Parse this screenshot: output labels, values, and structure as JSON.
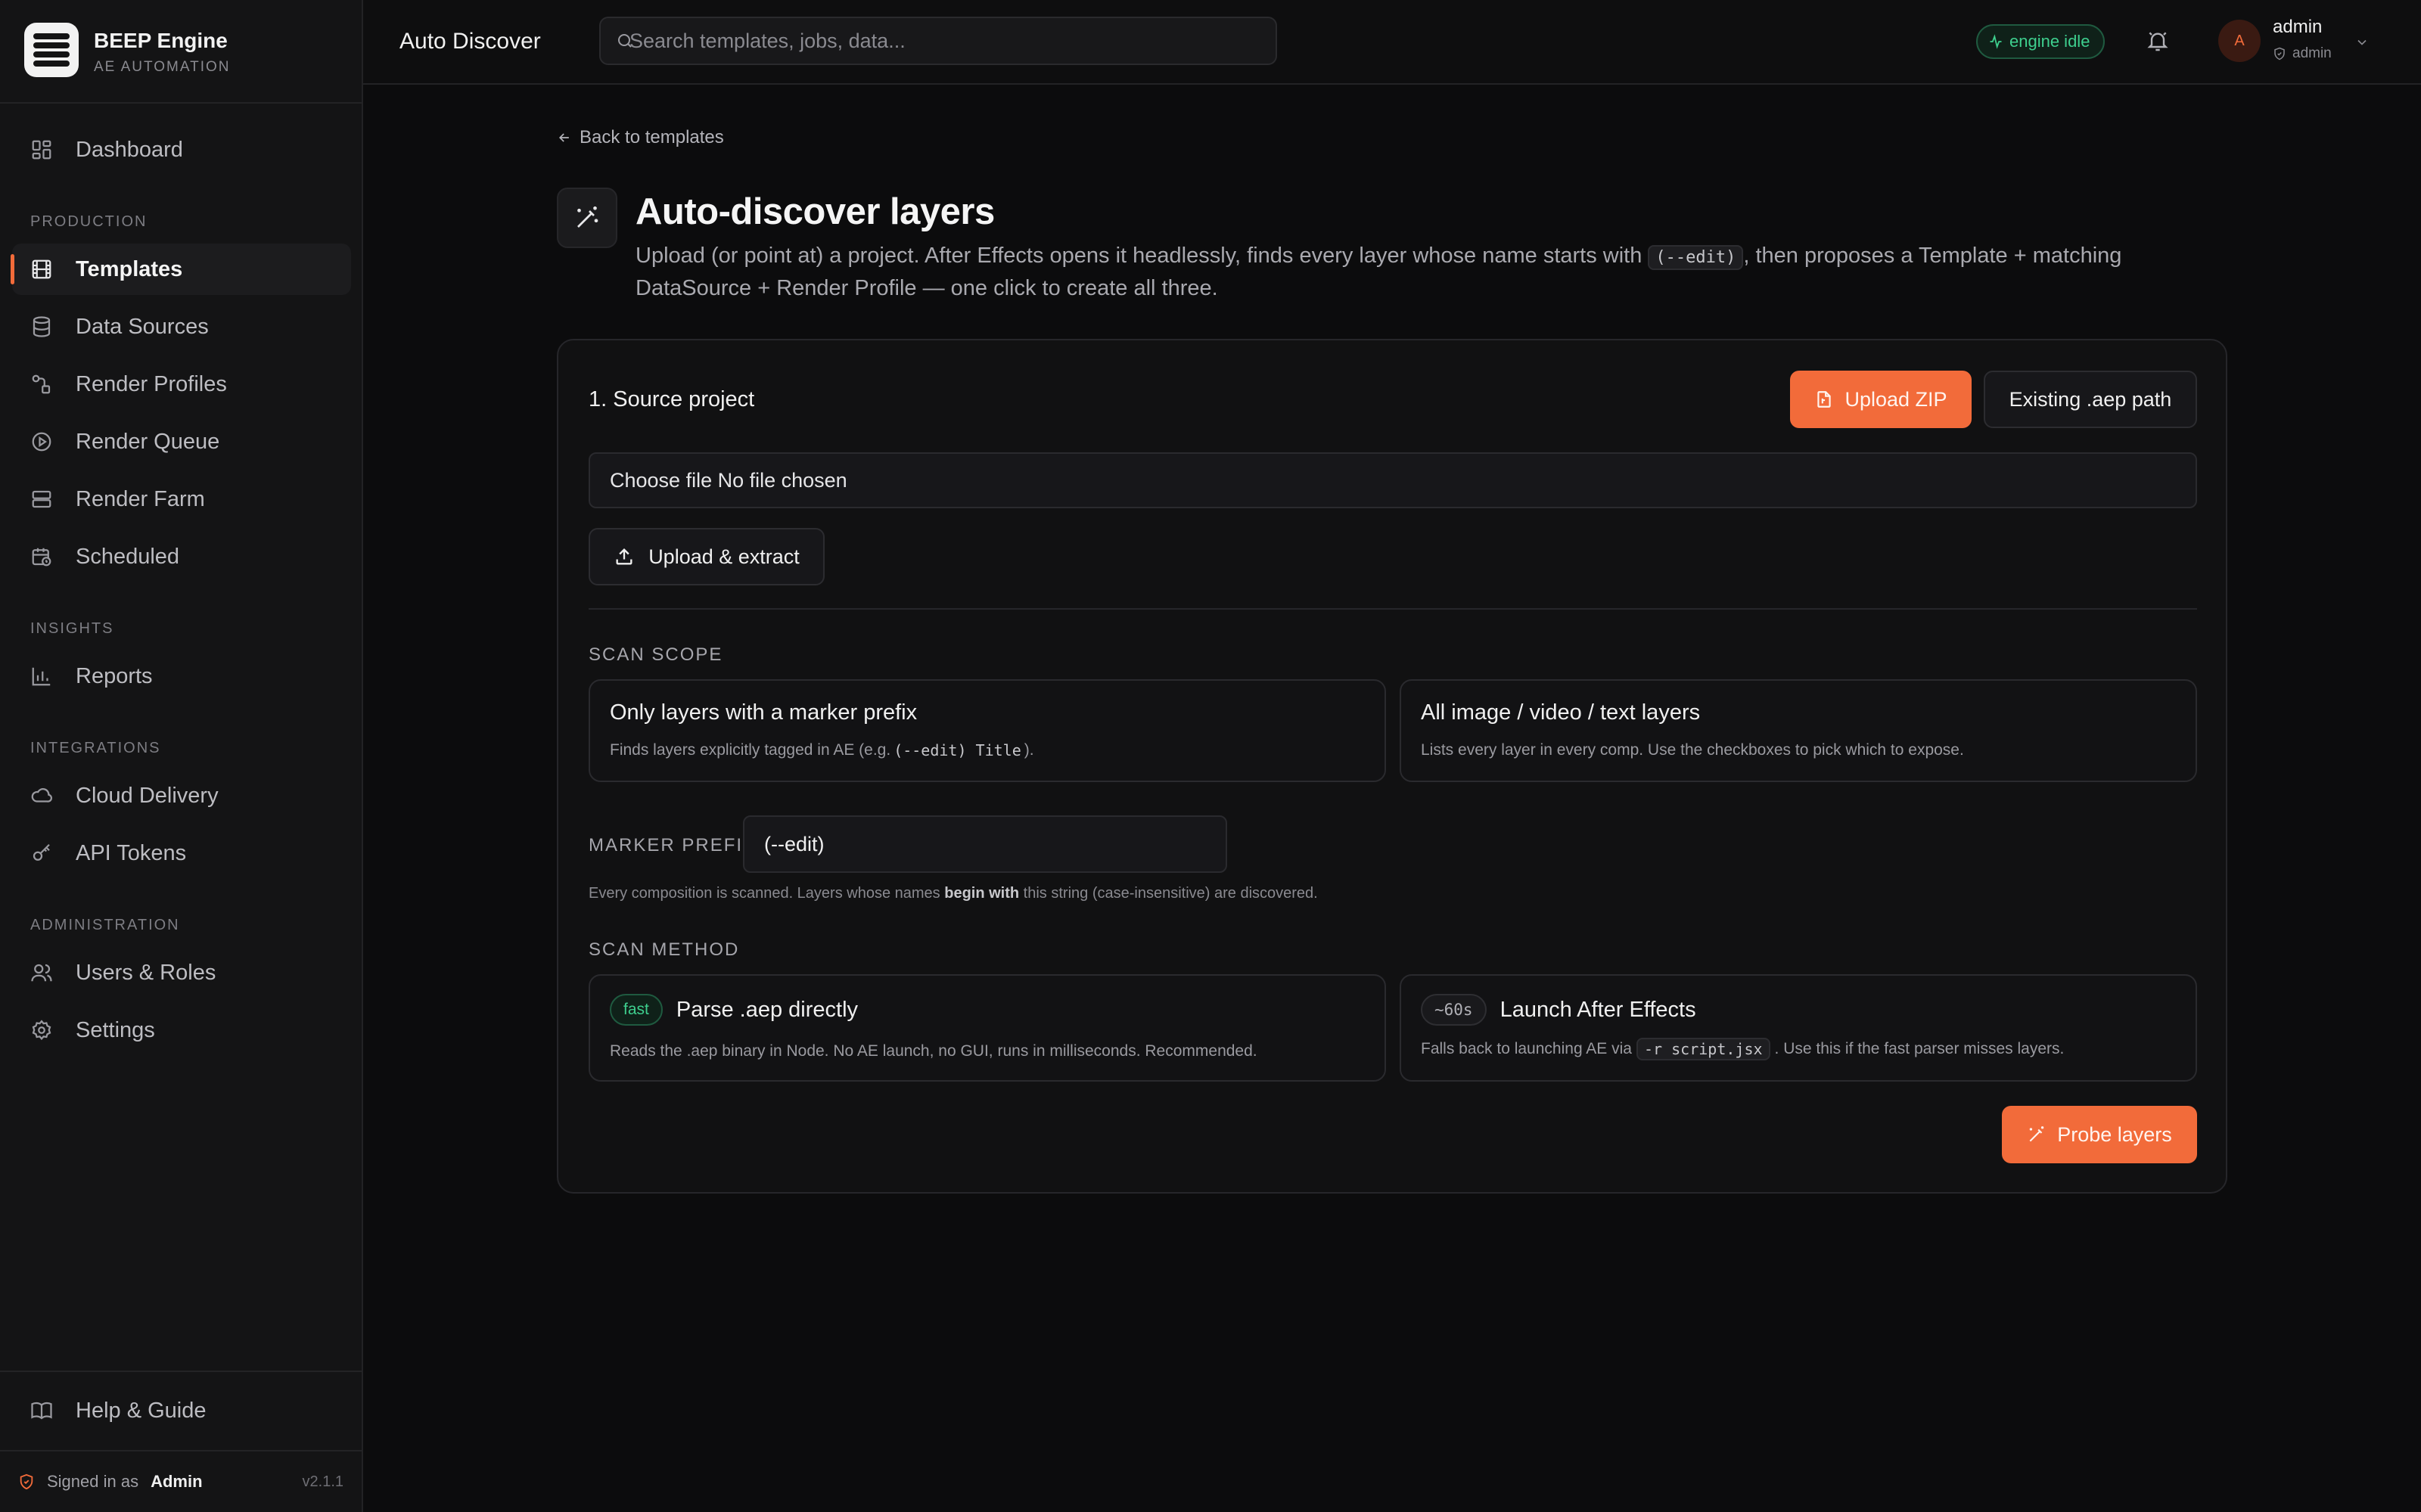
{
  "app": {
    "name": "BEEP Engine",
    "subtitle": "AE AUTOMATION",
    "version": "v2.1.1"
  },
  "sidebar": {
    "dashboard": "Dashboard",
    "sections": {
      "production": "PRODUCTION",
      "insights": "INSIGHTS",
      "integrations": "INTEGRATIONS",
      "administration": "ADMINISTRATION"
    },
    "production": [
      "Templates",
      "Data Sources",
      "Render Profiles",
      "Render Queue",
      "Render Farm",
      "Scheduled"
    ],
    "insights": [
      "Reports"
    ],
    "integrations": [
      "Cloud Delivery",
      "API Tokens"
    ],
    "administration": [
      "Users & Roles",
      "Settings"
    ],
    "help": "Help & Guide",
    "signed_in_label": "Signed in as",
    "signed_in_user": "Admin"
  },
  "topbar": {
    "title": "Auto Discover",
    "search_placeholder": "Search templates, jobs, data...",
    "status": "engine idle",
    "user_initial": "A",
    "user_name": "admin",
    "user_role": "admin"
  },
  "page": {
    "back": "Back to templates",
    "title": "Auto-discover layers",
    "desc_before": "Upload (or point at) a project. After Effects opens it headlessly, finds every layer whose name starts with ",
    "desc_code": "(--edit)",
    "desc_after": ", then proposes a Template + matching DataSource + Render Profile — one click to create all three."
  },
  "card": {
    "title": "1. Source project",
    "upload_zip": "Upload ZIP",
    "existing_path": "Existing .aep path",
    "file_field": "Choose file No file chosen",
    "upload_extract": "Upload & extract",
    "scan_scope_label": "SCAN SCOPE",
    "scope_options": [
      {
        "title": "Only layers with a marker prefix",
        "desc_before": "Finds layers explicitly tagged in AE (e.g. ",
        "desc_code": "(--edit) Title",
        "desc_after": ")."
      },
      {
        "title": "All image / video / text layers",
        "desc": "Lists every layer in every comp. Use the checkboxes to pick which to expose."
      }
    ],
    "marker_prefix_label": "MARKER PREFIX",
    "marker_prefix_value": "(--edit)",
    "hint_before": "Every composition is scanned. Layers whose names ",
    "hint_bold": "begin with",
    "hint_after": " this string (case-insensitive) are discovered.",
    "scan_method_label": "SCAN METHOD",
    "methods": [
      {
        "badge": "fast",
        "title": "Parse .aep directly",
        "desc": "Reads the .aep binary in Node. No AE launch, no GUI, runs in milliseconds. Recommended."
      },
      {
        "badge": "~60s",
        "title": "Launch After Effects",
        "desc_before": "Falls back to launching AE via ",
        "desc_code": "-r script.jsx",
        "desc_after": ". Use this if the fast parser misses layers."
      }
    ],
    "probe": "Probe layers"
  },
  "colors": {
    "accent": "#f26b3a",
    "success": "#3ecf8e",
    "background": "#0c0c0d",
    "sidebar": "#141415"
  },
  "icons": [
    "dashboard-icon",
    "film-icon",
    "database-icon",
    "route-icon",
    "play-circle-icon",
    "server-icon",
    "calendar-clock-icon",
    "bar-chart-icon",
    "cloud-icon",
    "key-icon",
    "users-icon",
    "gear-icon",
    "book-icon",
    "shield-icon",
    "search-icon",
    "activity-icon",
    "bell-icon",
    "chevron-down-icon",
    "arrow-left-icon",
    "wand-icon",
    "file-icon",
    "upload-icon"
  ]
}
